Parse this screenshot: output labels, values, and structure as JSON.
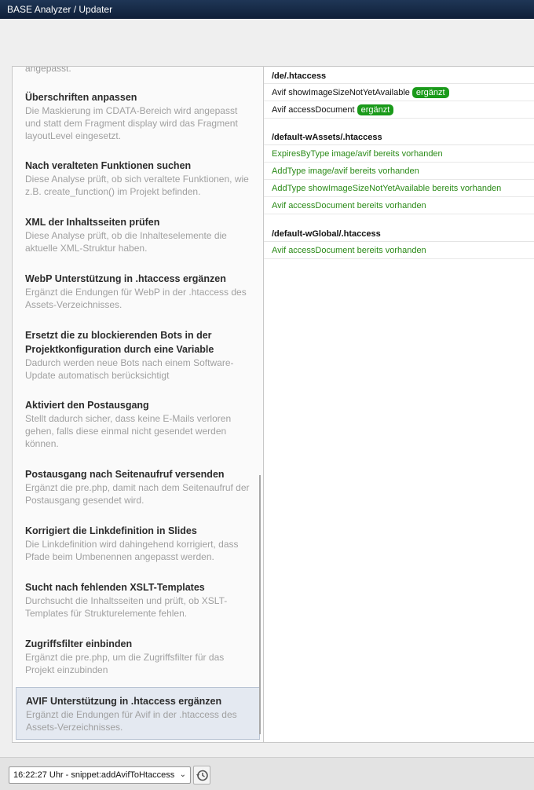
{
  "window": {
    "title": "BASE Analyzer / Updater"
  },
  "tasks": {
    "cut_top_text": "angepasst.",
    "items": [
      {
        "title": "Überschriften anpassen",
        "desc": "Die Maskierung im CDATA-Bereich wird angepasst und statt dem Fragment display wird das Fragment layoutLevel eingesetzt."
      },
      {
        "title": "Nach veralteten Funktionen suchen",
        "desc": "Diese Analyse prüft, ob sich veraltete Funktionen, wie z.B. create_function() im Projekt befinden."
      },
      {
        "title": "XML der Inhaltsseiten prüfen",
        "desc": "Diese Analyse prüft, ob die Inhalteselemente die aktuelle XML-Struktur haben."
      },
      {
        "title": "WebP Unterstützung in .htaccess ergänzen",
        "desc": "Ergänzt die Endungen für WebP in der .htaccess des Assets-Verzeichnisses."
      },
      {
        "title": "Ersetzt die zu blockierenden Bots in der Projektkonfiguration durch eine Variable",
        "desc": "Dadurch werden neue Bots nach einem Software-Update automatisch berücksichtigt"
      },
      {
        "title": "Aktiviert den Postausgang",
        "desc": "Stellt dadurch sicher, dass keine E-Mails verloren gehen, falls diese einmal nicht gesendet werden können."
      },
      {
        "title": "Postausgang nach Seitenaufruf versenden",
        "desc": "Ergänzt die pre.php, damit nach dem Seitenaufruf der Postausgang gesendet wird."
      },
      {
        "title": "Korrigiert die Linkdefinition in Slides",
        "desc": "Die Linkdefinition wird dahingehend korrigiert, dass Pfade beim Umbenennen angepasst werden."
      },
      {
        "title": "Sucht nach fehlenden XSLT-Templates",
        "desc": "Durchsucht die Inhaltsseiten und prüft, ob XSLT-Templates für Strukturelemente fehlen."
      },
      {
        "title": "Zugriffsfilter einbinden",
        "desc": "Ergänzt die pre.php, um die Zugriffsfilter für das Projekt einzubinden"
      },
      {
        "title": "AVIF Unterstützung in .htaccess ergänzen",
        "desc": "Ergänzt die Endungen für Avif in der .htaccess des Assets-Verzeichnisses."
      }
    ]
  },
  "results": {
    "sections": [
      {
        "header": "/de/.htaccess",
        "rows": [
          {
            "text": "Avif showImageSizeNotYetAvailable",
            "badge": "ergänzt",
            "status": "added"
          },
          {
            "text": "Avif accessDocument",
            "badge": "ergänzt",
            "status": "added"
          }
        ]
      },
      {
        "header": "/default-wAssets/.htaccess",
        "rows": [
          {
            "text": "ExpiresByType image/avif bereits vorhanden",
            "status": "exists"
          },
          {
            "text": "AddType image/avif bereits vorhanden",
            "status": "exists"
          },
          {
            "text": "AddType showImageSizeNotYetAvailable bereits vorhanden",
            "status": "exists"
          },
          {
            "text": "Avif accessDocument bereits vorhanden",
            "status": "exists"
          }
        ]
      },
      {
        "header": "/default-wGlobal/.htaccess",
        "rows": [
          {
            "text": "Avif accessDocument bereits vorhanden",
            "status": "exists"
          }
        ]
      }
    ]
  },
  "footer": {
    "log_select_value": "16:22:27 Uhr - snippet:addAvifToHtaccess",
    "history_icon": "history-icon"
  },
  "colors": {
    "titlebar": "#142844",
    "badge_added": "#1a9a1a",
    "exists_text": "#2a8a17",
    "selected_item": "#e4e9f1"
  }
}
